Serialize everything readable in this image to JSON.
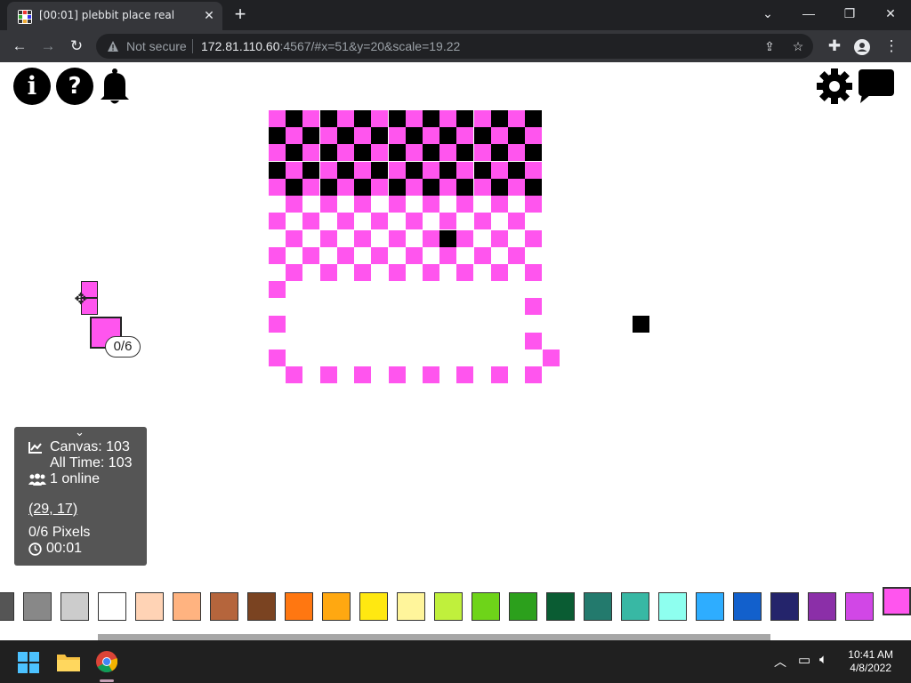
{
  "browser": {
    "tab_title": "[00:01] plebbit place real",
    "not_secure": "Not secure",
    "url_host": "172.81.110.60",
    "url_rest": ":4567/#x=51&y=20&scale=19.22"
  },
  "page": {
    "stats": {
      "canvas": "Canvas: 103",
      "all_time": "All Time: 103",
      "online": "1 online",
      "coords": "(29, 17)",
      "pixels": "0/6 Pixels",
      "timer": "00:01"
    },
    "cursor_counter": "0/6",
    "colors": {
      "pink": "#ff55ee",
      "black": "#000000",
      "panel": "#555555"
    },
    "palette": [
      "#555555",
      "#888888",
      "#cccccc",
      "#ffffff",
      "#ffd3b5",
      "#ffb380",
      "#b5653c",
      "#7a4321",
      "#ff7711",
      "#ffa811",
      "#ffe811",
      "#fff59b",
      "#c0f03c",
      "#6ed419",
      "#2ca01c",
      "#0a5c33",
      "#237a6d",
      "#38b8a4",
      "#8effef",
      "#2eadff",
      "#1260cc",
      "#24246b",
      "#8b2fa8",
      "#d147e6",
      "#ff55ee"
    ]
  },
  "taskbar": {
    "time": "10:41 AM",
    "date": "4/8/2022"
  }
}
